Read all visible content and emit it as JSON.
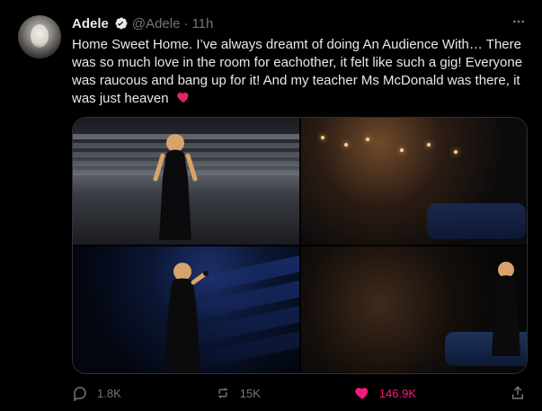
{
  "tweet": {
    "author_name": "Adele",
    "author_handle": "@Adele",
    "separator": "·",
    "time": "11h",
    "text": "Home Sweet Home. I’ve always dreamt of doing An Audience With… There was so much love in the room for eachother, it felt like such a gig! Everyone was raucous and bang up for it! And my teacher Ms McDonald was there, it was just heaven",
    "media": {
      "count": 4,
      "items": [
        {
          "subject": "singer-on-stage-black-dress"
        },
        {
          "subject": "theatre-audience-wide"
        },
        {
          "subject": "singer-with-microphone-blue-light"
        },
        {
          "subject": "audience-and-stage"
        }
      ]
    },
    "metrics": {
      "replies": "1.8K",
      "retweets": "15K",
      "likes": "146.9K"
    }
  },
  "colors": {
    "background": "#000000",
    "text": "#e7e9ea",
    "muted": "#71767b",
    "border": "#2f3336",
    "like": "#f91880",
    "verified": "#e7e9ea"
  },
  "icons": {
    "verified": "verified-badge-icon",
    "more": "more-horizontal-icon",
    "reply": "reply-icon",
    "retweet": "retweet-icon",
    "like": "heart-icon",
    "share": "share-icon"
  }
}
